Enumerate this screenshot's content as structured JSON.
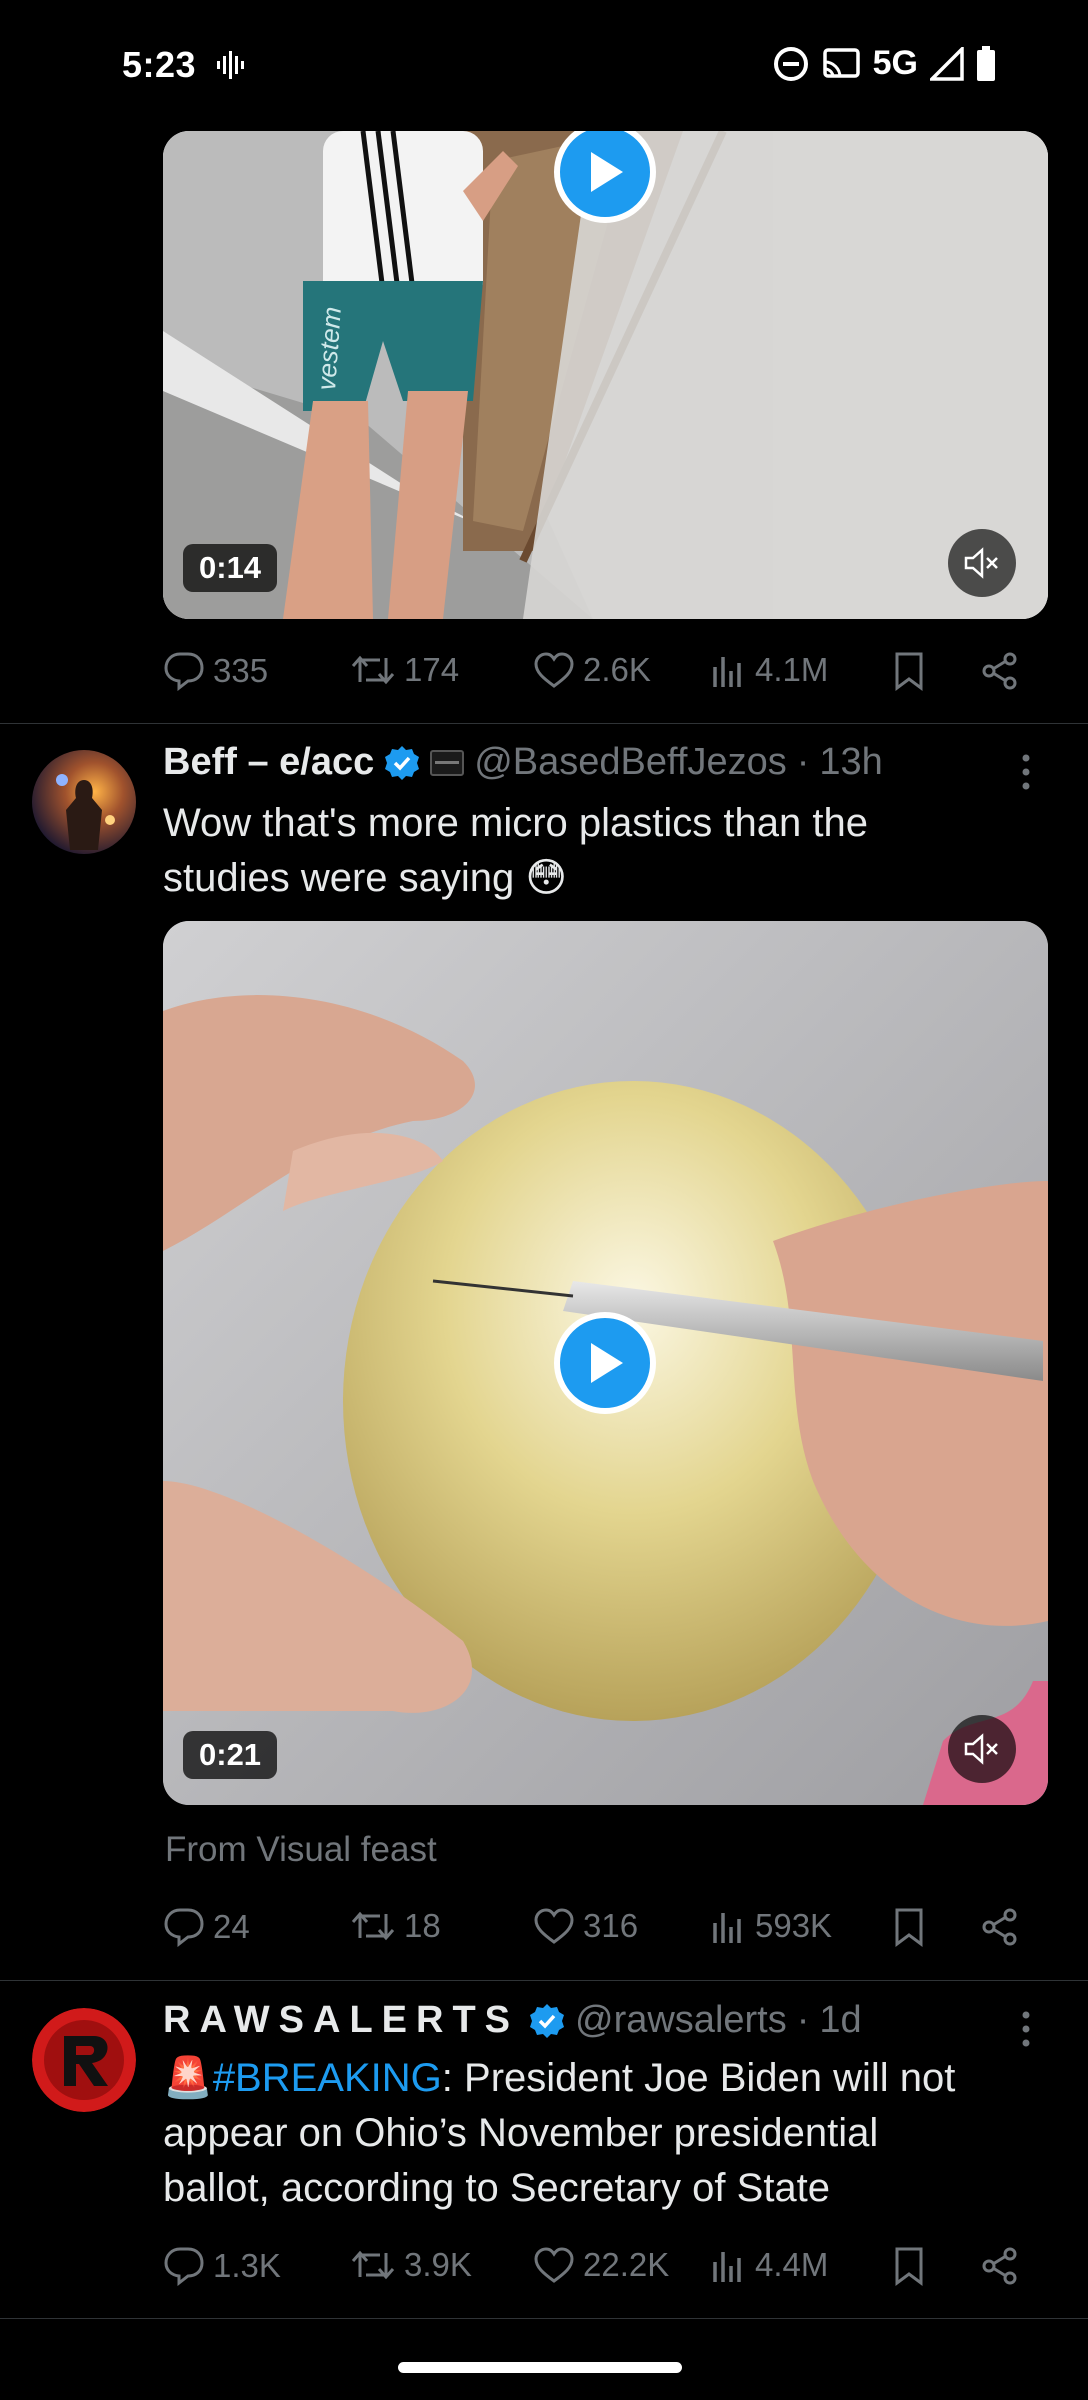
{
  "status_bar": {
    "time": "5:23",
    "network": "5G"
  },
  "tweet1": {
    "video_duration": "0:14",
    "shorts_text": "vestem",
    "stats": {
      "replies": "335",
      "reposts": "174",
      "likes": "2.6K",
      "views": "4.1M"
    }
  },
  "tweet2": {
    "name": "Beff – e/acc",
    "handle": "@BasedBeffJezos",
    "dot": "·",
    "time": "13h",
    "text_line1": "Wow that's more micro plastics than the",
    "text_line2": "studies were saying 😳",
    "video_duration": "0:21",
    "from": "From Visual feast",
    "stats": {
      "replies": "24",
      "reposts": "18",
      "likes": "316",
      "views": "593K"
    }
  },
  "tweet3": {
    "name": "RAWSALERTS",
    "handle": "@rawsalerts",
    "dot": "·",
    "time": "1d",
    "emoji": "🚨",
    "hashtag": "#BREAKING",
    "text_rest": ": President Joe Biden will not",
    "text_line2": "appear on Ohio’s November presidential",
    "text_line3": "ballot, according to Secretary of State",
    "stats": {
      "replies": "1.3K",
      "reposts": "3.9K",
      "likes": "22.2K",
      "views": "4.4M"
    }
  },
  "colors": {
    "accent": "#1d9bf0",
    "muted": "#71767b",
    "background": "#000000"
  },
  "icons": [
    "reply-icon",
    "repost-icon",
    "like-icon",
    "views-icon",
    "bookmark-icon",
    "share-icon",
    "play-icon",
    "mute-icon",
    "verified-icon",
    "more-icon"
  ]
}
